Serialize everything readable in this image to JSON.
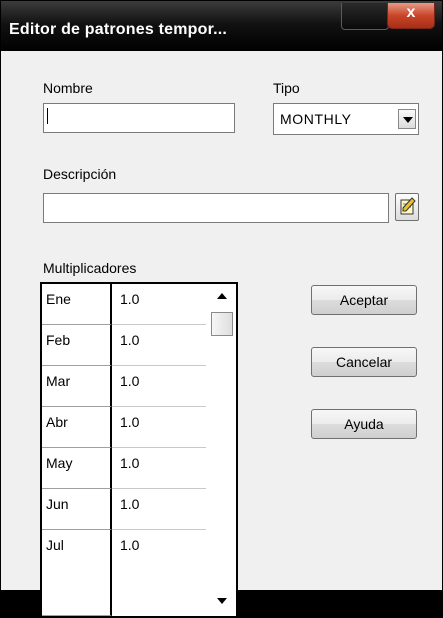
{
  "window": {
    "title": "Editor de patrones tempor...",
    "close_label": "x"
  },
  "form": {
    "name_label": "Nombre",
    "name_value": "",
    "type_label": "Tipo",
    "type_value": "MONTHLY",
    "description_label": "Descripción",
    "description_value": "",
    "multipliers_label": "Multiplicadores"
  },
  "multipliers": [
    {
      "month": "Ene",
      "value": "1.0"
    },
    {
      "month": "Feb",
      "value": "1.0"
    },
    {
      "month": "Mar",
      "value": "1.0"
    },
    {
      "month": "Abr",
      "value": "1.0"
    },
    {
      "month": "May",
      "value": "1.0"
    },
    {
      "month": "Jun",
      "value": "1.0"
    },
    {
      "month": "Jul",
      "value": "1.0"
    }
  ],
  "buttons": {
    "ok": "Aceptar",
    "cancel": "Cancelar",
    "help": "Ayuda"
  },
  "icons": {
    "edit": "pencil-edit-icon",
    "close": "close-icon"
  }
}
